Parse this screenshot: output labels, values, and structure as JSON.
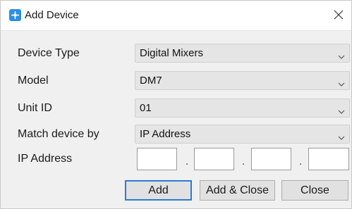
{
  "window": {
    "title": "Add Device",
    "close_icon": "close-icon",
    "app_icon": "app-logo-icon"
  },
  "form": {
    "device_type": {
      "label": "Device Type",
      "value": "Digital Mixers"
    },
    "model": {
      "label": "Model",
      "value": "DM7"
    },
    "unit_id": {
      "label": "Unit ID",
      "value": "01"
    },
    "match_by": {
      "label": "Match device by",
      "value": "IP Address"
    },
    "ip_address": {
      "label": "IP Address",
      "octets": [
        "",
        "",
        "",
        ""
      ],
      "separator": "."
    }
  },
  "buttons": {
    "add": "Add",
    "add_close": "Add & Close",
    "close": "Close"
  },
  "colors": {
    "accent": "#2a7bd4",
    "app_icon": "#2d8ee3",
    "dialog_bg": "#f0f0f0"
  }
}
